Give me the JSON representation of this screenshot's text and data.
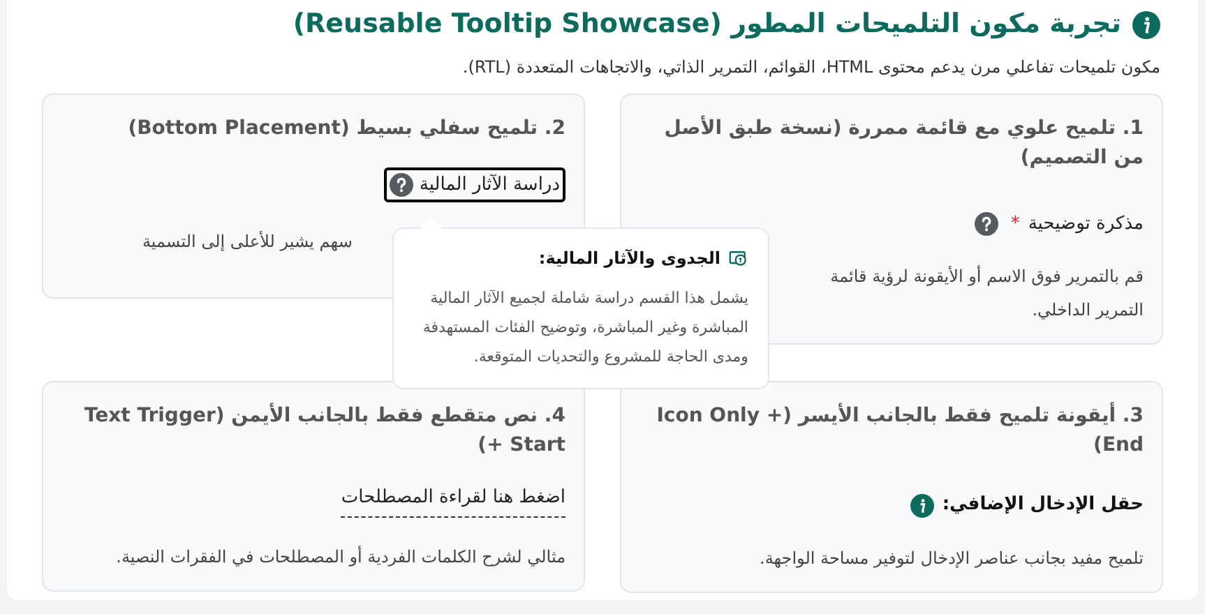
{
  "header": {
    "title": "تجربة مكون التلميحات المطور (Reusable Tooltip Showcase)",
    "subtitle": "مكون تلميحات تفاعلي مرن يدعم محتوى HTML، القوائم، التمرير الذاتي، والاتجاهات المتعددة (RTL)."
  },
  "cards": [
    {
      "kind": "label_help",
      "title": "1. تلميح علوي مع قائمة ممررة (نسخة طبق الأصل من التصميم)",
      "label": "مذكرة توضيحية",
      "required_mark": "*",
      "description_lines": [
        "قم بالتمرير فوق الاسم أو الأيقونة لرؤية قائمة",
        "التمرير الداخلي."
      ]
    },
    {
      "kind": "boxed_trigger",
      "title": "2. تلميح سفلي بسيط (Bottom Placement)",
      "label": "دراسة الآثار المالية",
      "focused": true,
      "description_lines": [
        "سهم يشير للأعلى إلى التسمية"
      ]
    },
    {
      "kind": "icon_only",
      "title": "3. أيقونة تلميح فقط بالجانب الأيسر (Icon Only + End)",
      "label": "حقل الإدخال الإضافي:",
      "description_lines": [
        "تلميح مفيد بجانب عناصر الإدخال لتوفير مساحة الواجهة."
      ]
    },
    {
      "kind": "text_trigger",
      "title": "4. نص متقطع فقط بالجانب الأيمن (Text Trigger + Start)",
      "label": "اضغط هنا لقراءة المصطلحات",
      "description_lines": [
        "مثالي لشرح الكلمات الفردية أو المصطلحات في الفقرات النصية."
      ]
    }
  ],
  "tooltip": {
    "title": "الجدوى والآثار المالية:",
    "body": "يشمل هذا القسم دراسة شاملة لجميع الآثار المالية المباشرة وغير المباشرة، وتوضيح الفئات المستهدفة ومدى الحاجة للمشروع والتحديات المتوقعة."
  }
}
